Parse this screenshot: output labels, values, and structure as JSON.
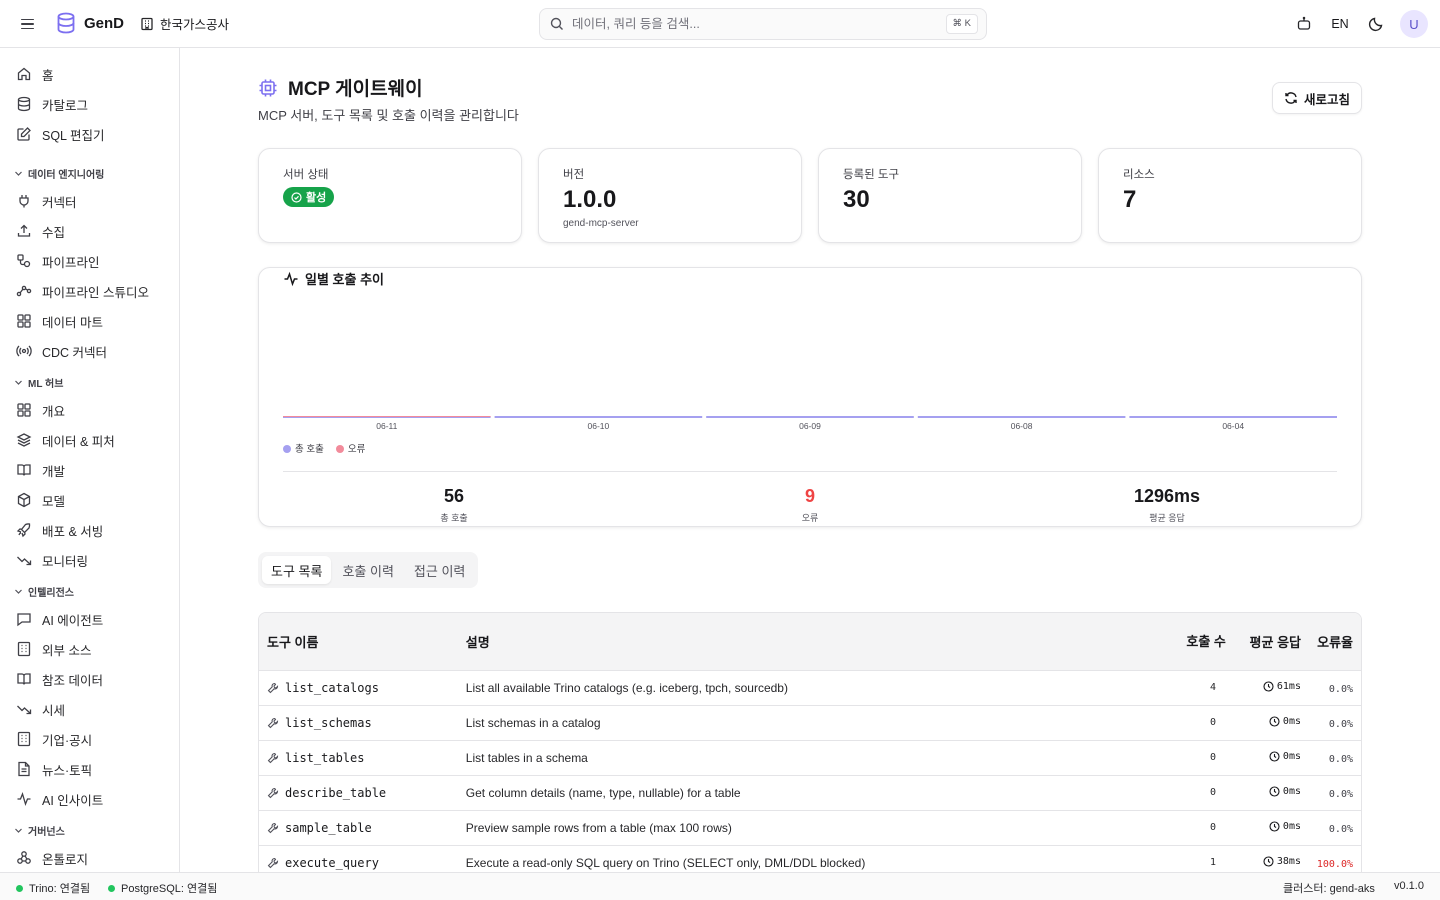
{
  "app": {
    "name": "GenD",
    "org": "한국가스공사"
  },
  "search": {
    "placeholder": "데이터, 쿼리 등을 검색...",
    "shortcut": "⌘ K"
  },
  "header": {
    "lang": "EN",
    "avatar": "U"
  },
  "sidebar": {
    "top": [
      {
        "label": "홈",
        "icon": "home-icon"
      },
      {
        "label": "카탈로그",
        "icon": "database-icon"
      },
      {
        "label": "SQL 편집기",
        "icon": "edit-icon"
      }
    ],
    "sections": [
      {
        "title": "데이터 엔지니어링",
        "items": [
          {
            "label": "커넥터",
            "icon": "plug-icon"
          },
          {
            "label": "수집",
            "icon": "upload-icon"
          },
          {
            "label": "파이프라인",
            "icon": "pipeline-icon"
          },
          {
            "label": "파이프라인 스튜디오",
            "icon": "workflow-icon"
          },
          {
            "label": "데이터 마트",
            "icon": "grid-icon"
          },
          {
            "label": "CDC 커넥터",
            "icon": "radio-icon"
          }
        ]
      },
      {
        "title": "ML 허브",
        "items": [
          {
            "label": "개요",
            "icon": "grid-icon"
          },
          {
            "label": "데이터 & 피처",
            "icon": "layers-icon"
          },
          {
            "label": "개발",
            "icon": "book-icon"
          },
          {
            "label": "모델",
            "icon": "box-icon"
          },
          {
            "label": "배포 & 서빙",
            "icon": "rocket-icon"
          },
          {
            "label": "모니터링",
            "icon": "trend-down-icon"
          }
        ]
      },
      {
        "title": "인텔리전스",
        "items": [
          {
            "label": "AI 에이전트",
            "icon": "message-icon"
          },
          {
            "label": "외부 소스",
            "icon": "building-icon"
          },
          {
            "label": "참조 데이터",
            "icon": "book-icon"
          },
          {
            "label": "시세",
            "icon": "trend-down-icon"
          },
          {
            "label": "기업·공시",
            "icon": "building-icon"
          },
          {
            "label": "뉴스·토픽",
            "icon": "file-icon"
          },
          {
            "label": "AI 인사이트",
            "icon": "activity-icon"
          }
        ]
      },
      {
        "title": "거버넌스",
        "items": [
          {
            "label": "온톨로지",
            "icon": "network-icon"
          }
        ]
      }
    ]
  },
  "page": {
    "title": "MCP 게이트웨이",
    "subtitle": "MCP 서버, 도구 목록 및 호출 이력을 관리합니다",
    "refresh_label": "새로고침"
  },
  "stats": {
    "status": {
      "label": "서버 상태",
      "value": "활성"
    },
    "version": {
      "label": "버전",
      "value": "1.0.0",
      "sub": "gend-mcp-server"
    },
    "tools": {
      "label": "등록된 도구",
      "value": "30"
    },
    "resources": {
      "label": "리소스",
      "value": "7"
    }
  },
  "chart_data": {
    "type": "bar",
    "title": "일별 호출 추이",
    "categories": [
      "06-11",
      "06-10",
      "06-09",
      "06-08",
      "06-04"
    ],
    "series": [
      {
        "name": "총 호출",
        "color": "#a5a0f0"
      },
      {
        "name": "오류",
        "color": "#f28b9b"
      }
    ],
    "legend": "bottom-left"
  },
  "summary": {
    "total": {
      "value": "56",
      "label": "총 호출"
    },
    "errors": {
      "value": "9",
      "label": "오류"
    },
    "avg": {
      "value": "1296ms",
      "label": "평균 응답"
    }
  },
  "tabs": [
    "도구 목록",
    "호출 이력",
    "접근 이력"
  ],
  "table": {
    "headers": {
      "name": "도구 이름",
      "desc": "설명",
      "calls": "호출 수",
      "resp": "평균 응답",
      "err": "오류율"
    },
    "rows": [
      {
        "name": "list_catalogs",
        "desc": "List all available Trino catalogs (e.g. iceberg, tpch, sourcedb)",
        "calls": "4",
        "resp": "61ms",
        "err": "0.0%",
        "bad": false
      },
      {
        "name": "list_schemas",
        "desc": "List schemas in a catalog",
        "calls": "0",
        "resp": "0ms",
        "err": "0.0%",
        "bad": false
      },
      {
        "name": "list_tables",
        "desc": "List tables in a schema",
        "calls": "0",
        "resp": "0ms",
        "err": "0.0%",
        "bad": false
      },
      {
        "name": "describe_table",
        "desc": "Get column details (name, type, nullable) for a table",
        "calls": "0",
        "resp": "0ms",
        "err": "0.0%",
        "bad": false
      },
      {
        "name": "sample_table",
        "desc": "Preview sample rows from a table (max 100 rows)",
        "calls": "0",
        "resp": "0ms",
        "err": "0.0%",
        "bad": false
      },
      {
        "name": "execute_query",
        "desc": "Execute a read-only SQL query on Trino (SELECT only, DML/DDL blocked)",
        "calls": "1",
        "resp": "38ms",
        "err": "100.0%",
        "bad": true
      }
    ]
  },
  "statusbar": {
    "trino": "Trino: 연결됨",
    "postgres": "PostgreSQL: 연결됨",
    "cluster": "클러스터: gend-aks",
    "version": "v0.1.0"
  }
}
